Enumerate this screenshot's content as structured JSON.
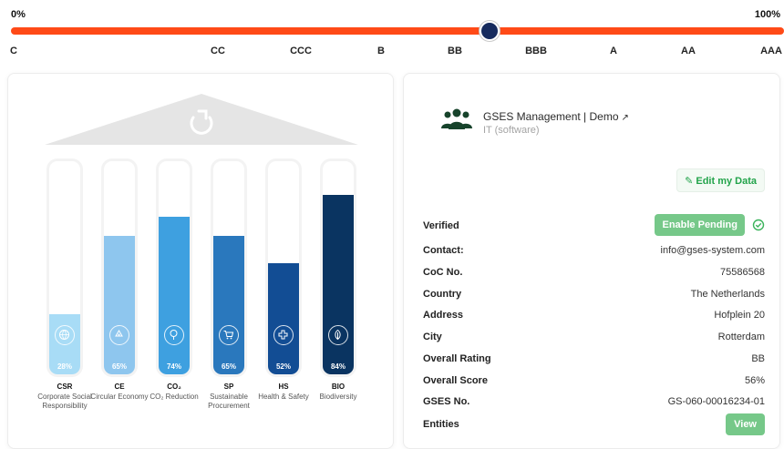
{
  "rating": {
    "min_label": "0%",
    "max_label": "100%",
    "current_grade": "BB",
    "grades": [
      "C",
      "CC",
      "CCC",
      "B",
      "BB",
      "BBB",
      "A",
      "AA",
      "AAA"
    ],
    "colors": {
      "track": "#ff4a17",
      "handle": "#162b5e"
    }
  },
  "pillars": [
    {
      "code": "CSR",
      "name": "Corporate Social Responsibility",
      "percent_label": "28%",
      "value": 28,
      "color": "#a8dcf6",
      "icon": "globe-icon"
    },
    {
      "code": "CE",
      "name": "Circular Economy",
      "percent_label": "65%",
      "value": 65,
      "color": "#8ec6ee",
      "icon": "recycle-icon"
    },
    {
      "code": "CO₂",
      "name": "CO₂ Reduction",
      "percent_label": "74%",
      "value": 74,
      "color": "#3ea0e0",
      "icon": "tree-icon"
    },
    {
      "code": "SP",
      "name": "Sustainable Procurement",
      "percent_label": "65%",
      "value": 65,
      "color": "#2a78bd",
      "icon": "cart-icon"
    },
    {
      "code": "HS",
      "name": "Health & Safety",
      "percent_label": "52%",
      "value": 52,
      "color": "#124d94",
      "icon": "health-icon"
    },
    {
      "code": "BIO",
      "name": "Biodiversity",
      "percent_label": "84%",
      "value": 84,
      "color": "#0a3461",
      "icon": "leaf-icon"
    }
  ],
  "company": {
    "name": "GSES Management | Demo",
    "external_link_icon": "external-link-icon",
    "sector": "IT (software)",
    "edit_label": "Edit my Data"
  },
  "details": {
    "verified": {
      "label": "Verified",
      "button": "Enable Pending"
    },
    "contact": {
      "label": "Contact:",
      "value": "info@gses-system.com"
    },
    "coc": {
      "label": "CoC No.",
      "value": "75586568"
    },
    "country": {
      "label": "Country",
      "value": "The Netherlands"
    },
    "address": {
      "label": "Address",
      "value": "Hofplein 20"
    },
    "city": {
      "label": "City",
      "value": "Rotterdam"
    },
    "overall_rating": {
      "label": "Overall Rating",
      "value": "BB"
    },
    "overall_score": {
      "label": "Overall Score",
      "value": "56%"
    },
    "gses_no": {
      "label": "GSES No.",
      "value": "GS-060-00016234-01"
    },
    "entities": {
      "label": "Entities",
      "button": "View"
    }
  }
}
